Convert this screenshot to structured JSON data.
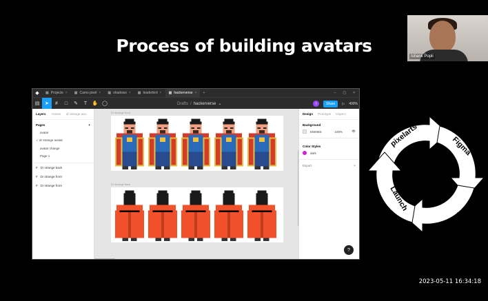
{
  "slide": {
    "title": "Process of building avatars",
    "timestamp": "2023-05-11  16:34:18"
  },
  "webcam": {
    "participant_name": "Ishank Popli"
  },
  "figma": {
    "tabs": [
      {
        "label": "Projects",
        "active": false
      },
      {
        "label": "Camo pixel",
        "active": false
      },
      {
        "label": "shadows",
        "active": false
      },
      {
        "label": "leaderbrd",
        "active": false
      },
      {
        "label": "hackerverse",
        "active": true
      }
    ],
    "breadcrumb": {
      "folder": "Drafts",
      "separator": "/",
      "file": "hackerverse"
    },
    "toolbar": {
      "share_label": "Share",
      "zoom": "400%",
      "user_initial": "I",
      "play_label": "▷"
    },
    "left_panel": {
      "tab_layers": "Layers",
      "tab_assets": "Assets",
      "current_page": "dr strange ava..",
      "pages_heading": "Pages",
      "add_label": "+",
      "pages": [
        {
          "name": "avatar",
          "selected": false
        },
        {
          "name": "dr strange avatar",
          "selected": true
        },
        {
          "name": "avatar change",
          "selected": false
        },
        {
          "name": "Page 1",
          "selected": false
        }
      ],
      "layers": [
        {
          "name": "Dr strange back"
        },
        {
          "name": "Dr strange front"
        },
        {
          "name": "Dr strange front"
        }
      ]
    },
    "right_panel": {
      "tab_design": "Design",
      "tab_prototype": "Prototype",
      "tab_inspect": "Inspect",
      "background_heading": "Background",
      "background_hex": "E5E5E5",
      "background_opacity": "100%",
      "color_styles_heading": "Color Styles",
      "color_style_name": "dark",
      "color_style_hex": "#d61ed6",
      "export_heading": "Export",
      "export_add": "+"
    },
    "canvas": {
      "frame1_label": "Dr strange front",
      "frame2_label": "Dr strange back",
      "sprite_count": 5
    },
    "help_label": "?"
  },
  "cycle": {
    "labels": [
      "pixelarts",
      "Figma",
      "Testing",
      "Launch"
    ],
    "arrow_color": "#ffffff",
    "label_color": "#000000"
  }
}
